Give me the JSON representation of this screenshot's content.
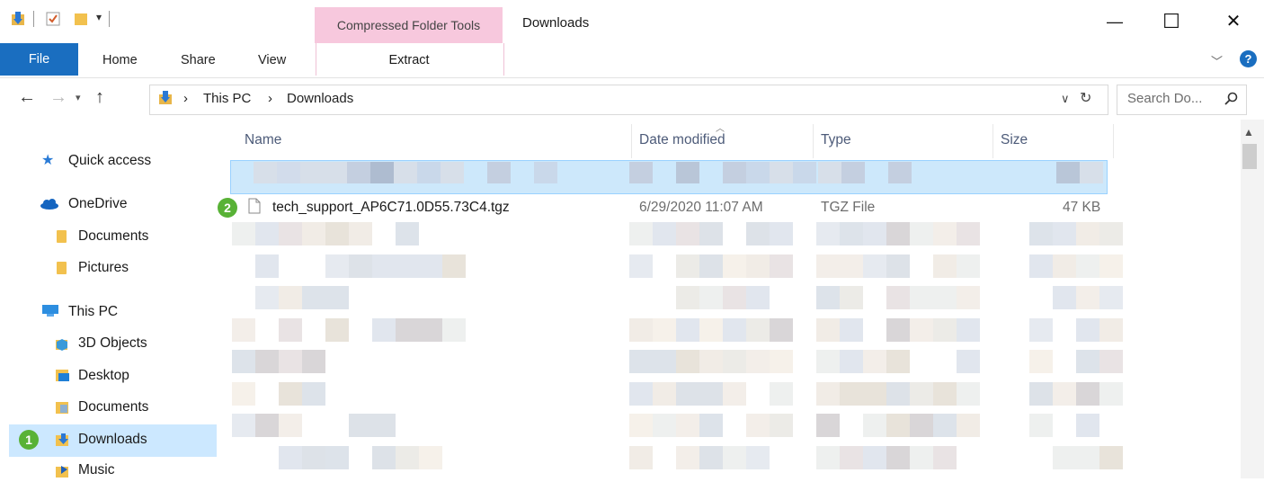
{
  "window": {
    "title": "Downloads",
    "context_tab_group": "Compressed Folder Tools",
    "controls": {
      "minimize": "—",
      "maximize": "☐",
      "close": "✕"
    }
  },
  "ribbon": {
    "tabs": [
      "File",
      "Home",
      "Share",
      "View"
    ],
    "context_tab": "Extract",
    "collapse_glyph": "﹀",
    "help_glyph": "?"
  },
  "address": {
    "crumbs": [
      "This PC",
      "Downloads"
    ],
    "separator": "›",
    "search_placeholder": "Search Do..."
  },
  "nav": {
    "items": [
      {
        "label": "Quick access",
        "icon": "star-icon"
      },
      {
        "label": "OneDrive",
        "icon": "cloud-icon"
      },
      {
        "label": "Documents",
        "icon": "folder-icon"
      },
      {
        "label": "Pictures",
        "icon": "folder-icon"
      },
      {
        "label": "This PC",
        "icon": "computer-icon"
      },
      {
        "label": "3D Objects",
        "icon": "3d-objects-icon"
      },
      {
        "label": "Desktop",
        "icon": "desktop-folder-icon"
      },
      {
        "label": "Documents",
        "icon": "documents-folder-icon"
      },
      {
        "label": "Downloads",
        "icon": "downloads-folder-icon"
      },
      {
        "label": "Music",
        "icon": "music-folder-icon"
      }
    ],
    "selected": "Downloads"
  },
  "columns": [
    "Name",
    "Date modified",
    "Type",
    "Size"
  ],
  "file_row": {
    "name": "tech_support_AP6C71.0D55.73C4.tgz",
    "date": "6/29/2020 11:07 AM",
    "type": "TGZ File",
    "size": "47 KB"
  },
  "badges": [
    "1",
    "2"
  ],
  "colors": {
    "file_tab": "#1a6ec0",
    "context_tab": "#f7c8dd",
    "selection": "#cce8ff",
    "badge": "#58b236"
  }
}
